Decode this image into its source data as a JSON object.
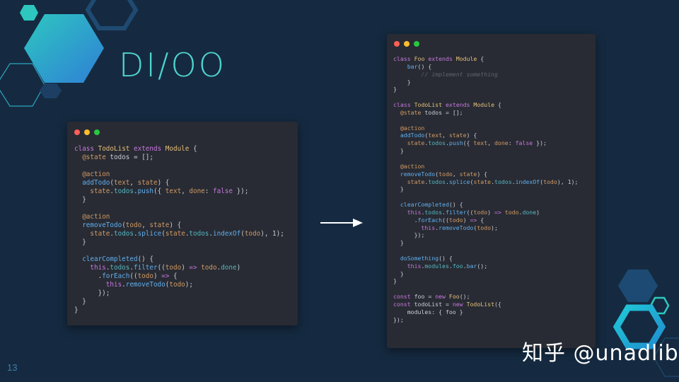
{
  "slide": {
    "title": "DI/OO",
    "page_number": "13",
    "watermark": "知乎 @unadlib"
  },
  "colors": {
    "background": "#152a40",
    "accent_teal": "#4fd3cf",
    "code_window": "#282b33",
    "keyword": "#c678dd",
    "class_name": "#e5c07b",
    "function": "#61afef",
    "decorator": "#d19a66",
    "property": "#56b6c2",
    "comment": "#5c6370"
  },
  "icons": [
    "window-close-dot",
    "window-minimize-dot",
    "window-zoom-dot",
    "right-arrow-icon",
    "hexagon-decoration"
  ],
  "code_before": {
    "lines": [
      "class TodoList extends Module {",
      "  @state todos = [];",
      "",
      "  @action",
      "  addTodo(text, state) {",
      "    state.todos.push({ text, done: false });",
      "  }",
      "",
      "  @action",
      "  removeTodo(todo, state) {",
      "    state.todos.splice(state.todos.indexOf(todo), 1);",
      "  }",
      "",
      "  clearCompleted() {",
      "    this.todos.filter((todo) => todo.done)",
      "      .forEach((todo) => {",
      "        this.removeTodo(todo);",
      "      });",
      "  }",
      "}"
    ]
  },
  "code_after": {
    "lines": [
      "class Foo extends Module {",
      "    bar() {",
      "        // implement something",
      "    }",
      "}",
      "",
      "class TodoList extends Module {",
      "  @state todos = [];",
      "",
      "  @action",
      "  addTodo(text, state) {",
      "    state.todos.push({ text, done: false });",
      "  }",
      "",
      "  @action",
      "  removeTodo(todo, state) {",
      "    state.todos.splice(state.todos.indexOf(todo), 1);",
      "  }",
      "",
      "  clearCompleted() {",
      "    this.todos.filter((todo) => todo.done)",
      "      .forEach((todo) => {",
      "        this.removeTodo(todo);",
      "      });",
      "  }",
      "",
      "  doSomething() {",
      "    this.modules.foo.bar();",
      "  }",
      "}",
      "",
      "const foo = new Foo();",
      "const todoList = new TodoList({",
      "    modules: { foo }",
      "});"
    ]
  }
}
